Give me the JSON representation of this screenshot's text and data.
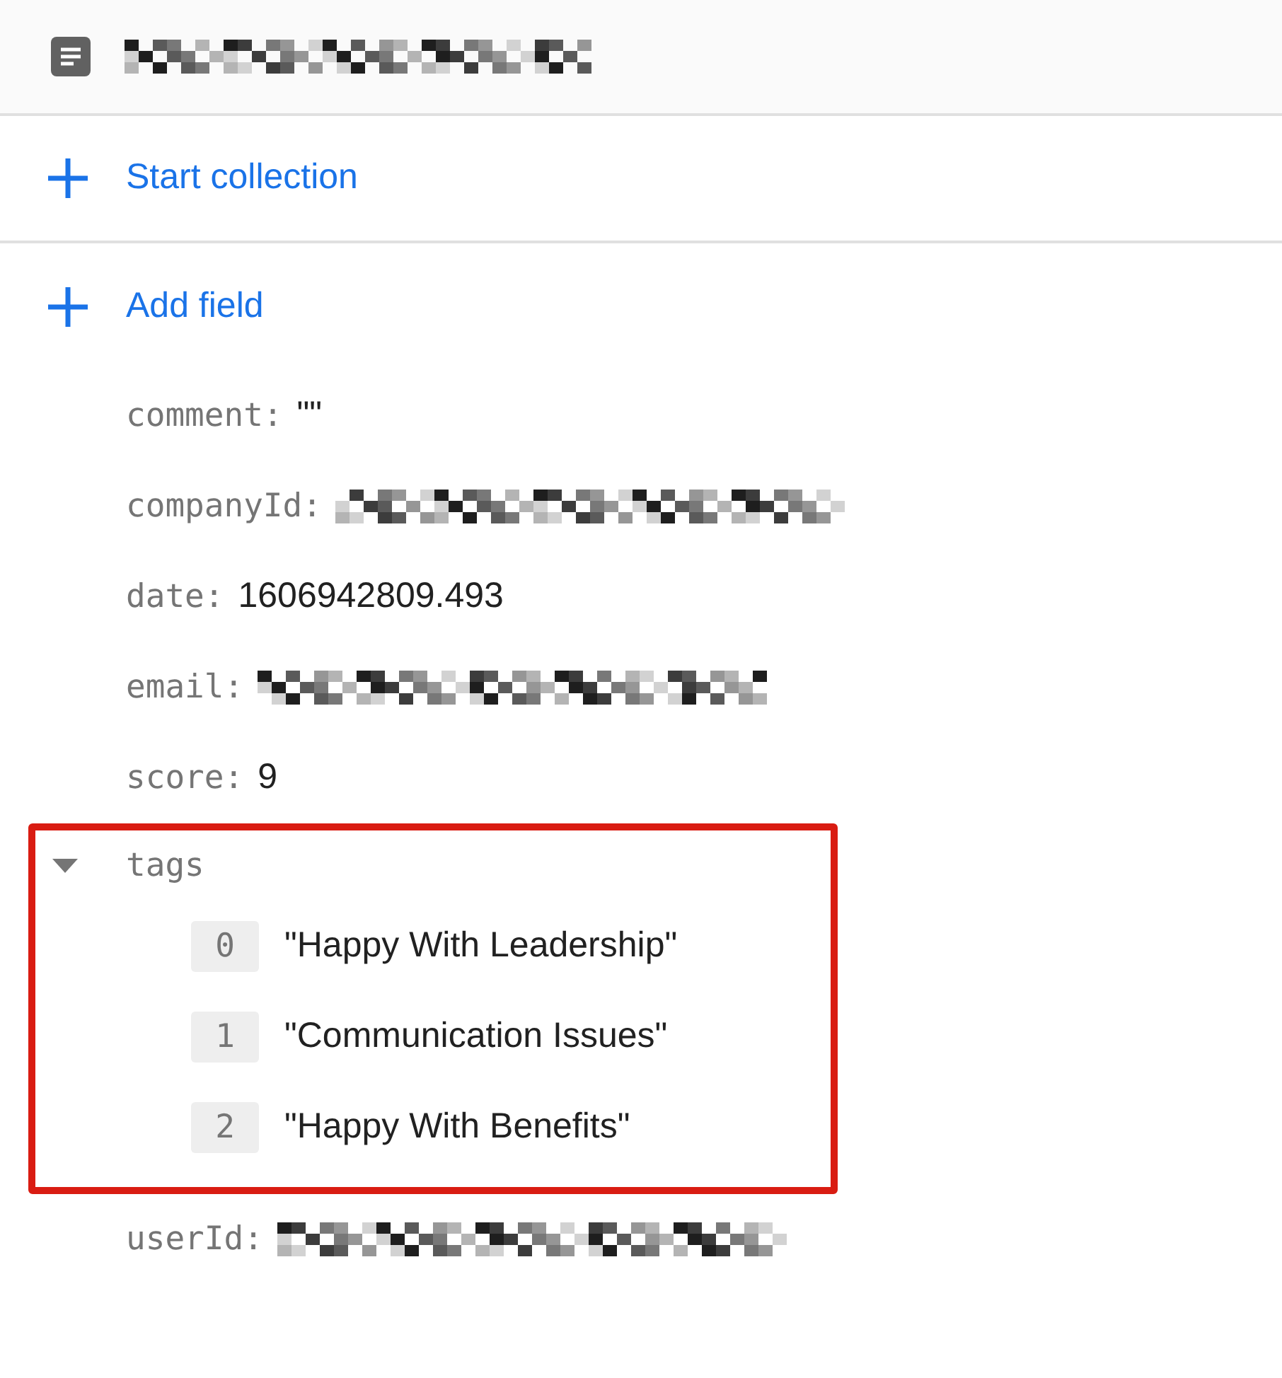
{
  "header": {
    "title_redacted": true
  },
  "actions": [
    {
      "label": "Start collection"
    },
    {
      "label": "Add field"
    }
  ],
  "fields": [
    {
      "kind": "text",
      "name": "comment:",
      "value": "\"\""
    },
    {
      "kind": "redacted",
      "name": "companyId:"
    },
    {
      "kind": "text",
      "name": "date:",
      "value": "1606942809.493"
    },
    {
      "kind": "redacted",
      "name": "email:"
    },
    {
      "kind": "text",
      "name": "score:",
      "value": "9"
    },
    {
      "kind": "array",
      "name": "tags",
      "expanded": true,
      "highlighted": true,
      "items": [
        {
          "index": "0",
          "value": "\"Happy With Leadership\""
        },
        {
          "index": "1",
          "value": "\"Communication Issues\""
        },
        {
          "index": "2",
          "value": "\"Happy With Benefits\""
        }
      ]
    },
    {
      "kind": "redacted",
      "name": "userId:"
    }
  ]
}
